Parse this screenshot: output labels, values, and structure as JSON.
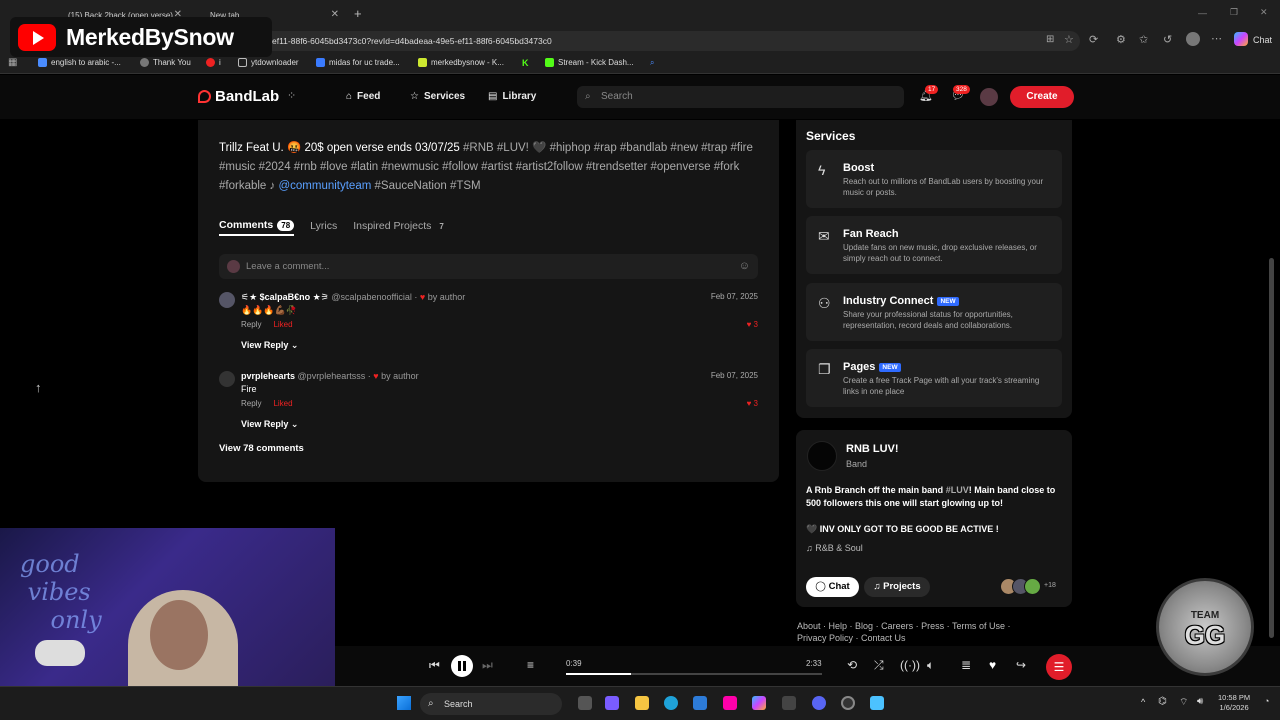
{
  "browser": {
    "tabs": [
      {
        "label": "(15) Back 2back (open verse)"
      },
      {
        "label": "New tab"
      }
    ],
    "new_tab": "+",
    "url": "ef11-88f6-6045bd3473c0?revId=d4badeaa-49e5-ef11-88f6-6045bd3473c0",
    "chat_label": "Chat",
    "bookmarks": [
      {
        "label": "english to arabic -..."
      },
      {
        "label": "Thank You"
      },
      {
        "label": "i"
      },
      {
        "label": "ytdownloader"
      },
      {
        "label": "midas for uc trade..."
      },
      {
        "label": "merkedbysnow - K..."
      },
      {
        "label": "Stream - Kick Dash..."
      }
    ]
  },
  "overlay": {
    "channel_name": "MerkedBySnow"
  },
  "header": {
    "logo": "BandLab",
    "nav": [
      {
        "label": "Feed"
      },
      {
        "label": "Services"
      },
      {
        "label": "Library"
      }
    ],
    "search_placeholder": "Search",
    "notifications_count": "17",
    "messages_count": "328",
    "create_label": "Create"
  },
  "post": {
    "title_prefix": "Trillz Feat U. 🤬  20$ open verse ends 03/07/25",
    "tags_line": "#RNB #LUV! 🖤 #hiphop #rap #bandlab #new #trap #fire #music #2024 #rnb #love #latin #newmusic #follow #artist #artist2follow #trendsetter #openverse #fork #forkable ♪",
    "mention": "@communityteam",
    "tail_tags": "#SauceNation #TSM",
    "tabs": [
      {
        "label": "Comments",
        "count": "78"
      },
      {
        "label": "Lyrics",
        "count": ""
      },
      {
        "label": "Inspired Projects",
        "count": "7"
      }
    ],
    "comment_placeholder": "Leave a comment...",
    "comments": [
      {
        "name": "⚟★ $calpaB€no ★⚞",
        "handle": "@scalpabenoofficial",
        "by_author": "by author",
        "date": "Feb 07, 2025",
        "text": "🔥🔥🔥💪🏾🥀",
        "reply": "Reply",
        "liked": "Liked",
        "likes": "3",
        "view_reply": "View Reply"
      },
      {
        "name": "pvrplehearts",
        "handle": "@pvrpleheartsss",
        "by_author": "by author",
        "date": "Feb 07, 2025",
        "text": "Fire",
        "reply": "Reply",
        "liked": "Liked",
        "likes": "3",
        "view_reply": "View Reply"
      }
    ],
    "view_all": "View 78 comments"
  },
  "services": {
    "title": "Services",
    "items": [
      {
        "title": "Boost",
        "desc": "Reach out to millions of BandLab users by boosting your music or posts.",
        "new": "",
        "icon": "bolt-icon"
      },
      {
        "title": "Fan Reach",
        "desc": "Update fans on new music, drop exclusive releases, or simply reach out to connect.",
        "new": "",
        "icon": "mail-icon"
      },
      {
        "title": "Industry Connect",
        "desc": "Share your professional status for opportunities, representation, record deals and collaborations.",
        "new": "NEW",
        "icon": "people-icon"
      },
      {
        "title": "Pages",
        "desc": "Create a free Track Page with all your track's streaming links in one place",
        "new": "NEW",
        "icon": "pages-icon"
      }
    ]
  },
  "band": {
    "name": "RNB LUV!",
    "type": "Band",
    "desc_a": "A Rnb Branch off the main band",
    "desc_tag": "#LUV",
    "desc_b": "! Main band close to 500 followers this one will start glowing up to!",
    "note": "🖤 INV ONLY GOT TO BE GOOD BE ACTIVE !",
    "genre": "R&B & Soul",
    "chat_label": "Chat",
    "projects_label": "Projects",
    "members_more": "+18"
  },
  "footer": {
    "links": [
      "About",
      "Help",
      "Blog",
      "Careers",
      "Press",
      "Terms of Use",
      "Privacy Policy",
      "Contact Us"
    ]
  },
  "player": {
    "current": "0:39",
    "duration": "2:33",
    "progress_fraction": 0.255
  },
  "overlay_badge": {
    "top": "TEAM",
    "big": "GG"
  },
  "taskbar": {
    "search_label": "Search",
    "time": "10:58 PM",
    "date": "1/6/2026"
  },
  "colors": {
    "accent": "#e11d2a",
    "mention": "#5aa0ff",
    "new_badge": "#2f6bff"
  }
}
